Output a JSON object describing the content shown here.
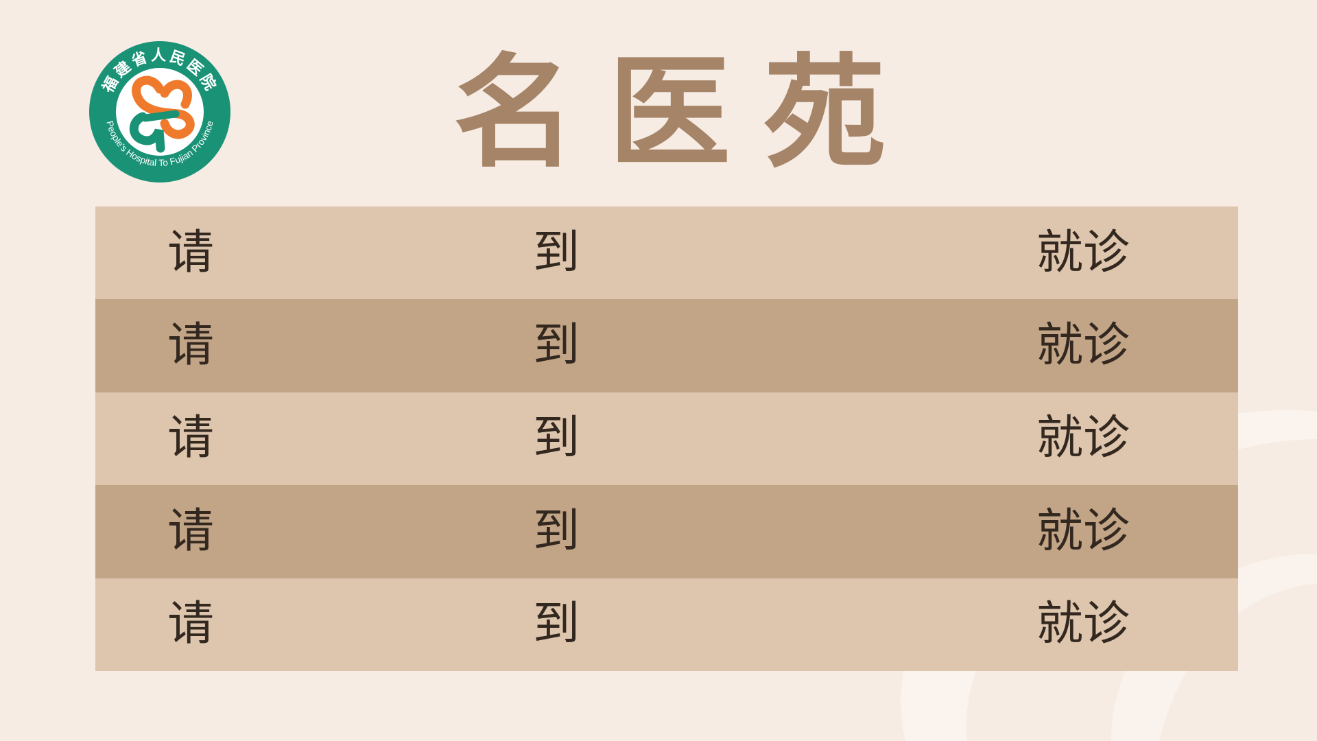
{
  "colors": {
    "background": "#f6ece4",
    "title": "#a68468",
    "row_light": "#dec6ae",
    "row_dark": "#c2a487",
    "text": "#33281f",
    "logo_green": "#1a9276",
    "logo_orange": "#ef7a2c"
  },
  "logo": {
    "chinese_text": "福建省人民医院",
    "english_text": "People's Hospital To Fujian Province"
  },
  "title": "名医苑",
  "rows": [
    {
      "prefix": "请",
      "middle": "到",
      "suffix": "就诊"
    },
    {
      "prefix": "请",
      "middle": "到",
      "suffix": "就诊"
    },
    {
      "prefix": "请",
      "middle": "到",
      "suffix": "就诊"
    },
    {
      "prefix": "请",
      "middle": "到",
      "suffix": "就诊"
    },
    {
      "prefix": "请",
      "middle": "到",
      "suffix": "就诊"
    }
  ]
}
